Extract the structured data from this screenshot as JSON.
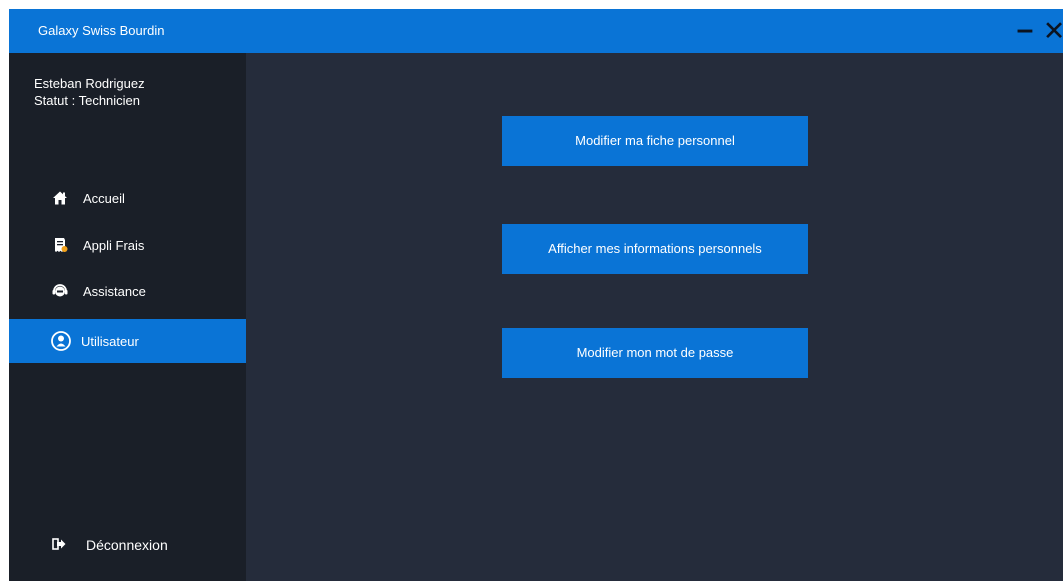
{
  "window": {
    "title": "Galaxy Swiss Bourdin",
    "minimize_glyph": "–",
    "close_glyph": "✕"
  },
  "user": {
    "name": "Esteban Rodriguez",
    "status_label": "Statut :",
    "status_value": "Technicien"
  },
  "nav": {
    "items": [
      {
        "label": "Accueil",
        "icon": "home-icon"
      },
      {
        "label": "Appli Frais",
        "icon": "receipt-icon"
      },
      {
        "label": "Assistance",
        "icon": "headset-icon"
      },
      {
        "label": "Utilisateur",
        "icon": "user-icon",
        "active": true
      }
    ],
    "logout_label": "Déconnexion",
    "logout_icon": "logout-icon"
  },
  "actions": {
    "edit_profile": "Modifier ma fiche personnel",
    "show_info": "Afficher mes informations personnels",
    "change_password": "Modifier mon mot de passe"
  },
  "colors": {
    "accent": "#0a74d6",
    "sidebar": "#1a1f28",
    "content": "#252c3b"
  }
}
